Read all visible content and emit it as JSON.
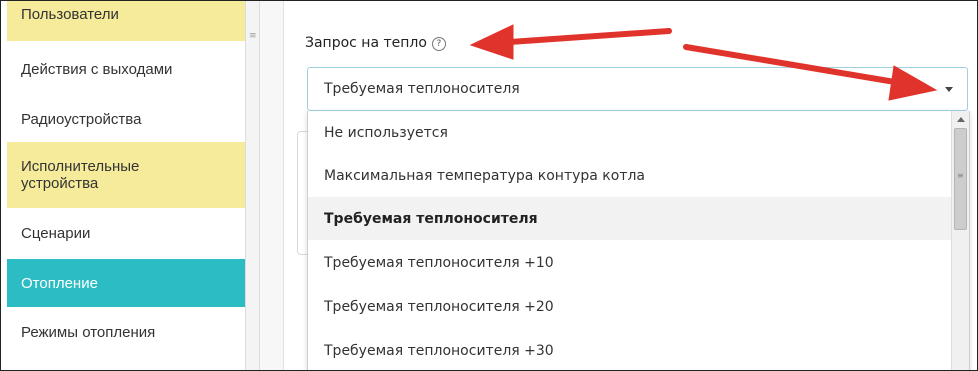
{
  "sidebar": {
    "items": [
      {
        "label": "Пользователи",
        "style": "yellow"
      },
      {
        "label": "Действия с выходами",
        "style": "plain"
      },
      {
        "label": "Радиоустройства",
        "style": "plain"
      },
      {
        "label": "Исполнительные устройства",
        "style": "yellow"
      },
      {
        "label": "Сценарии",
        "style": "plain"
      },
      {
        "label": "Отопление",
        "style": "teal"
      },
      {
        "label": "Режимы отопления",
        "style": "plain"
      }
    ]
  },
  "form": {
    "field_label": "Запрос на тепло",
    "help_icon": "?",
    "select_value": "Требуемая теплоносителя"
  },
  "dropdown": {
    "options": [
      "Не используется",
      "Максимальная температура контура котла",
      "Требуемая теплоносителя",
      "Требуемая теплоносителя +10",
      "Требуемая теплоносителя +20",
      "Требуемая теплоносителя +30"
    ],
    "selected_index": 2
  },
  "colors": {
    "sidebar_yellow": "#f6eb9a",
    "sidebar_teal": "#2bbcc4",
    "annotation_arrow": "#e0332b"
  }
}
